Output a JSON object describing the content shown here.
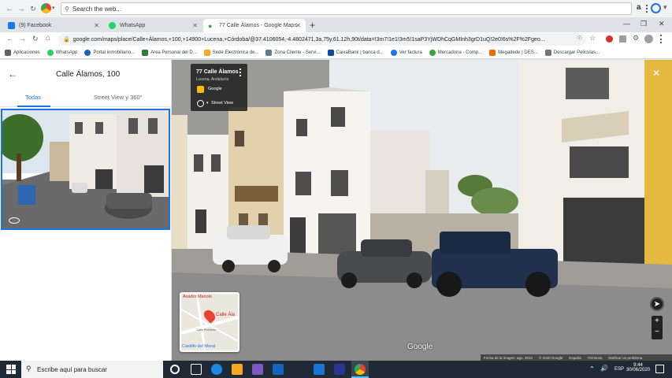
{
  "browser": {
    "search_placeholder": "Search the web...",
    "tabs": [
      {
        "label": "(9) Facebook",
        "color": "#1877f2"
      },
      {
        "label": "WhatsApp",
        "color": "#25d366"
      },
      {
        "label": "77 Calle Álamos - Google Maps",
        "color": "#34a853"
      }
    ],
    "url": "google.com/maps/place/Calle+Álamos,+100,+14900+Lucena,+Córdoba/@37.4106054,-4.4802471,3a,75y,61.12h,90t/data=!3m7!1e1!3m5!1saP3YjWDhCqGMInh3grD1uQ!2e0!6s%2F%2Fgeo...",
    "bookmarks": [
      {
        "label": "Aplicaciones",
        "color": "#5f6368"
      },
      {
        "label": "WhatsApp",
        "color": "#25d366"
      },
      {
        "label": "Portal inmobiliario...",
        "color": "#1565c0"
      },
      {
        "label": "Area Personal del D...",
        "color": "#2e7d32"
      },
      {
        "label": "Sede Electrónica de...",
        "color": "#f9a825"
      },
      {
        "label": "Zona Cliente - Servi...",
        "color": "#607d8b"
      },
      {
        "label": "CaixaBank | banca d...",
        "color": "#0d47a1"
      },
      {
        "label": "Ver factura",
        "color": "#1a73e8"
      },
      {
        "label": "Mercadona - Comp...",
        "color": "#43a047"
      },
      {
        "label": "Megadede | DES...",
        "color": "#ef6c00"
      },
      {
        "label": "Descargar Peliculas...",
        "color": "#757575"
      }
    ]
  },
  "panel": {
    "title": "Calle Álamos, 100",
    "tab_all": "Todas",
    "tab_street": "Street View y 360°"
  },
  "info": {
    "title": "77 Calle Álamos",
    "subtitle": "Lucena, Andalucía",
    "provider": "Google",
    "street_view": "Street View"
  },
  "minimap": {
    "poi": "Asador Manolo",
    "place": "Calle Ála",
    "street": "Calle Perfumes",
    "castle": "Castillo del Moral"
  },
  "map": {
    "watermark": "Google",
    "footer": [
      "Fecha de la imagen: ago. 2012",
      "© 2020 Google",
      "España",
      "Términos",
      "Notificar un problema"
    ]
  },
  "taskbar": {
    "search_placeholder": "Escribe aquí para buscar",
    "time": "9:44",
    "date": "30/06/2020",
    "lang": "ESP"
  }
}
